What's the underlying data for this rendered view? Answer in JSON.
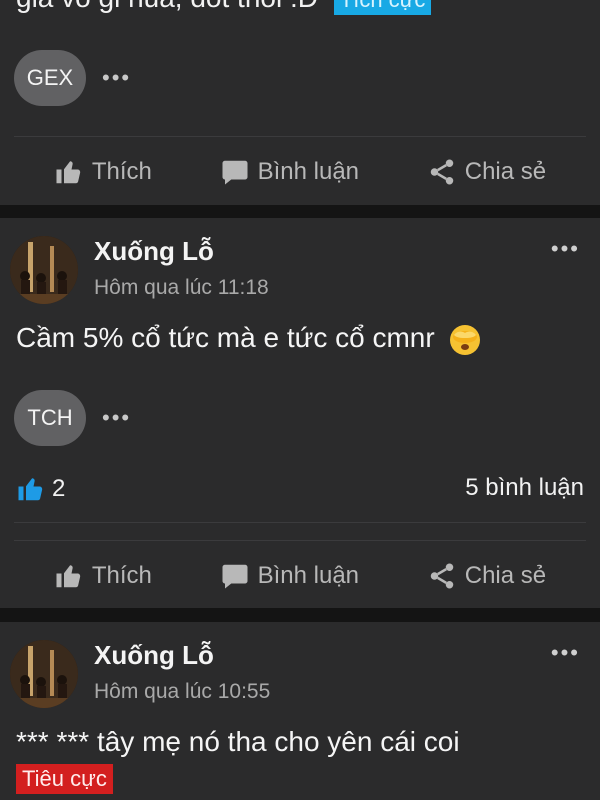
{
  "post0": {
    "text_fragment": "gia vo gi nua, dot thoi :D",
    "sentiment": "Tích cực",
    "tag": "GEX"
  },
  "actions": {
    "like": "Thích",
    "comment": "Bình luận",
    "share": "Chia sẻ"
  },
  "posts": [
    {
      "author": "Xuống Lỗ",
      "time": "Hôm qua lúc 11:18",
      "text": "Cầm 5% cổ tức mà e tức cổ cmnr",
      "emoji": "face-with-hand-over-eyes-emoji",
      "tag": "TCH",
      "likes": "2",
      "comments": "5 bình luận"
    },
    {
      "author": "Xuống Lỗ",
      "time": "Hôm qua lúc 10:55",
      "text": "*** *** tây mẹ nó tha cho yên cái coi",
      "sentiment": "Tiêu cực"
    }
  ],
  "more_dots": "•••",
  "colors": {
    "background": "#2b2b2c",
    "positive": "#18a9e5",
    "negative": "#d31f1f",
    "like_blue": "#1e9be6"
  }
}
